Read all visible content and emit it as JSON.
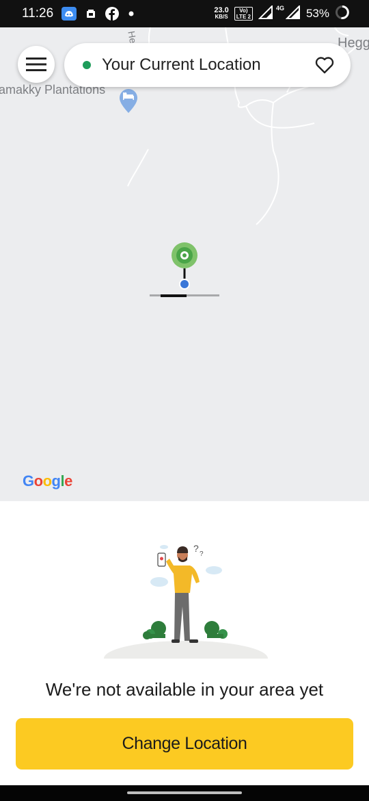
{
  "status_bar": {
    "time": "11:26",
    "net_speed_value": "23.0",
    "net_speed_unit": "KB/S",
    "volte_top": "Vo)",
    "volte_bottom": "LTE 2",
    "network": "4G",
    "battery": "53%",
    "icons": [
      "discord-icon",
      "gallery-icon",
      "facebook-icon",
      "dot-icon",
      "signal-icon",
      "signal-icon",
      "battery-ring-icon"
    ]
  },
  "map": {
    "labels": {
      "plantation": "amakky Plantations",
      "top_road": "Hego",
      "top_right": "Hegg"
    },
    "google": [
      "G",
      "o",
      "o",
      "g",
      "l",
      "e"
    ],
    "google_colors": [
      "#4285F4",
      "#EA4335",
      "#FBBC05",
      "#4285F4",
      "#34A853",
      "#EA4335"
    ]
  },
  "header": {
    "location_text": "Your Current Location",
    "location_status_color": "#1e9c5a"
  },
  "sheet": {
    "message": "We're not available in your area yet",
    "cta_label": "Change Location",
    "cta_color": "#fcca22"
  }
}
